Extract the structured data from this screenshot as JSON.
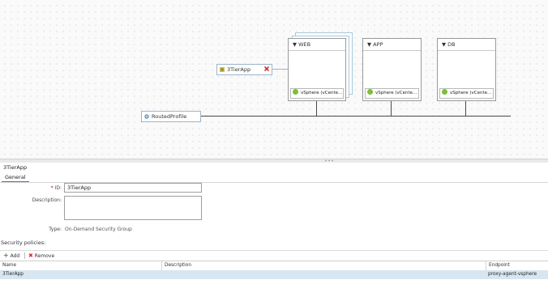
{
  "canvas": {
    "tiers": [
      {
        "name": "WEB",
        "endpoint": "vSphere (vCente..."
      },
      {
        "name": "APP",
        "endpoint": "vSphere (vCente..."
      },
      {
        "name": "DB",
        "endpoint": "vSphere (vCente..."
      }
    ],
    "security_group_node": "3TierApp",
    "network_node": "RoutedProfile"
  },
  "panel": {
    "title": "3TierApp",
    "tab_general": "General",
    "id_label": "ID:",
    "id_value": "3TierApp",
    "description_label": "Description:",
    "description_value": "",
    "type_label": "Type:",
    "type_value": "On-Demand Security Group",
    "security_policies_label": "Security policies:",
    "toolbar": {
      "add_label": "Add",
      "remove_label": "Remove"
    },
    "grid": {
      "columns": [
        "Name",
        "Description",
        "Endpoint"
      ],
      "rows": [
        {
          "name": "3TierApp",
          "description": "",
          "endpoint": "proxy-agent-vsphere"
        }
      ]
    }
  }
}
